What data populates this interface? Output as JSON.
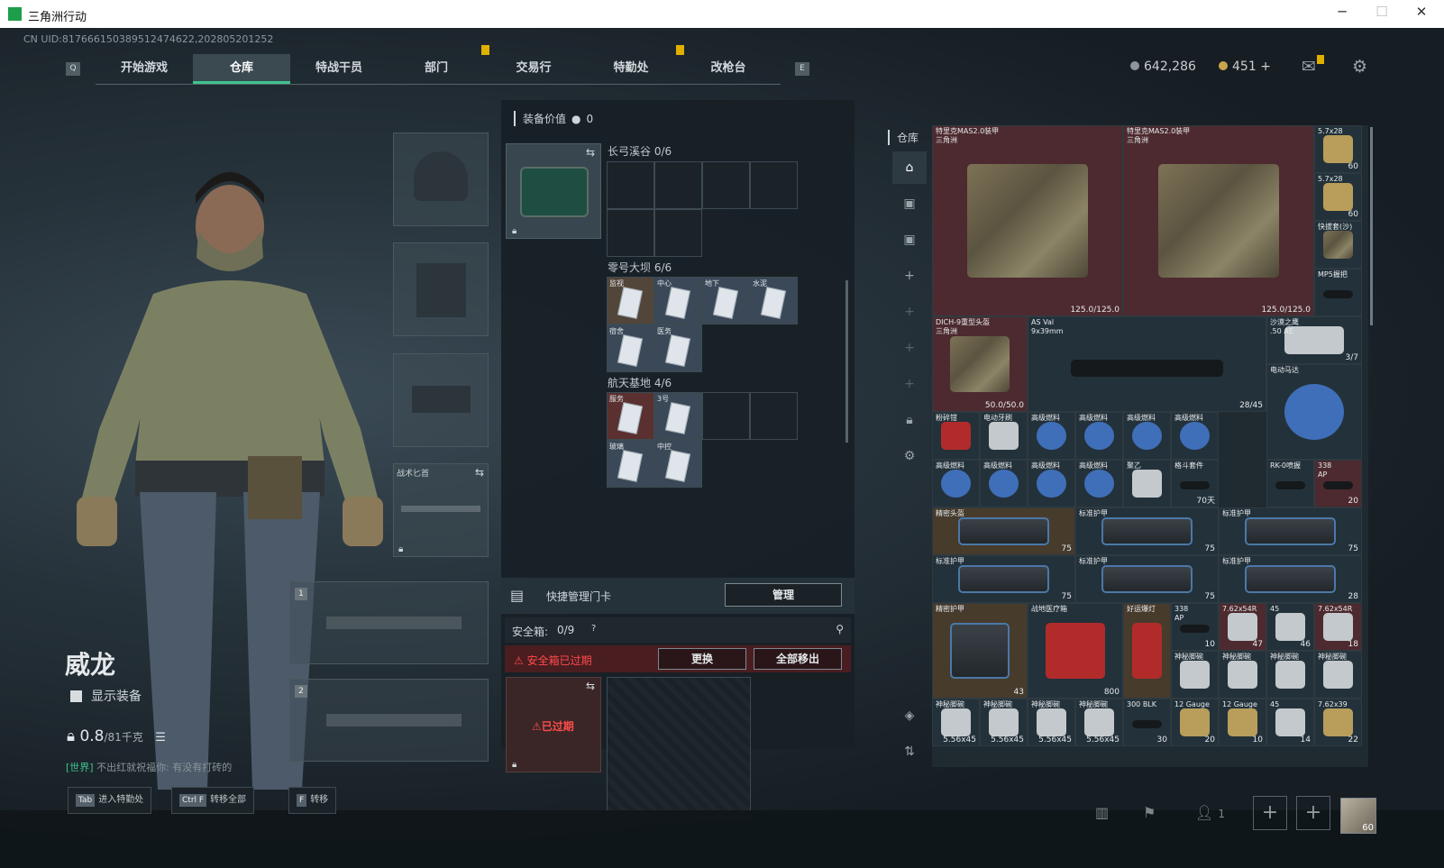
{
  "window": {
    "title": "三角洲行动"
  },
  "uid": "CN UID:817666150389512474622,202805201252",
  "nav": {
    "tabs": [
      {
        "label": "开始游戏"
      },
      {
        "label": "仓库",
        "active": true
      },
      {
        "label": "特战干员"
      },
      {
        "label": "部门"
      },
      {
        "label": "交易行"
      },
      {
        "label": "特勤处"
      },
      {
        "label": "改枪台"
      }
    ],
    "key_left": "Q",
    "key_right": "E"
  },
  "currency": {
    "silver": "642,286",
    "gold": "451",
    "gold_plus": "+"
  },
  "operator": {
    "name": "威龙",
    "show_equipment_label": "显示装备",
    "weight_value": "0.8",
    "weight_limit": "/81千克",
    "chat_channel": "[世界]",
    "chat_user": "不出红就祝福你",
    "chat_msg": "有没有打砖的"
  },
  "equipment": {
    "melee_label": "战术匕首",
    "primary_slot": "1",
    "secondary_slot": "2"
  },
  "loadout": {
    "title": "装备价值",
    "value": "0",
    "keycard_groups": [
      {
        "title": "长弓溪谷",
        "count": "0/6",
        "cards": []
      },
      {
        "title": "零号大坝",
        "count": "6/6",
        "cards": [
          "监视",
          "中心",
          "地下",
          "水泥",
          "宿舍",
          "医务"
        ]
      },
      {
        "title": "航天基地",
        "count": "4/6",
        "cards": [
          "服务",
          "3号",
          "玻璃",
          "中控"
        ]
      }
    ],
    "quick_manage_label": "快捷管理门卡",
    "manage_button": "管理",
    "safe_box_label": "安全箱:",
    "safe_box_count": "0/9",
    "safe_expired_msg": "安全箱已过期",
    "replace_button": "更换",
    "move_all_button": "全部移出",
    "case_expired_label": "已过期"
  },
  "stash": {
    "title": "仓库",
    "items": [
      {
        "name": "特里克MAS2.0装甲\n三角洲",
        "value": "125.0/125.0"
      },
      {
        "name": "特里克MAS2.0装甲\n三角洲",
        "value": "125.0/125.0"
      },
      {
        "name": "5.7x28",
        "value": "60"
      },
      {
        "name": "5.7x28",
        "value": "60"
      },
      {
        "name": "快拔套(沙)",
        "value": ""
      },
      {
        "name": "MP5握把",
        "value": ""
      },
      {
        "name": "DICH-9重型头盔\n三角洲",
        "value": "50.0/50.0"
      },
      {
        "name": "AS Val\n9x39mm",
        "value": "28/45"
      },
      {
        "name": "沙漠之鹰\n.50 AE",
        "value": "3/7"
      },
      {
        "name": "电动马达",
        "value": ""
      },
      {
        "name": "粉碎钳",
        "value": ""
      },
      {
        "name": "电动牙刷",
        "value": ""
      },
      {
        "name": "高级燃料",
        "value": ""
      },
      {
        "name": "高级燃料",
        "value": ""
      },
      {
        "name": "高级燃料",
        "value": ""
      },
      {
        "name": "高级燃料",
        "value": ""
      },
      {
        "name": "高级燃料",
        "value": ""
      },
      {
        "name": "高级燃料",
        "value": ""
      },
      {
        "name": "高级燃料",
        "value": ""
      },
      {
        "name": "高级燃料",
        "value": ""
      },
      {
        "name": "聚乙",
        "value": ""
      },
      {
        "name": "格斗套件",
        "value": "70天"
      },
      {
        "name": "RK-0喷握",
        "value": ""
      },
      {
        "name": "338\nAP",
        "value": "20"
      },
      {
        "name": "精密头盔",
        "value": "75"
      },
      {
        "name": "标准护甲",
        "value": "75"
      },
      {
        "name": "标准护甲",
        "value": "75"
      },
      {
        "name": "标准护甲",
        "value": "75"
      },
      {
        "name": "标准护甲",
        "value": "75"
      },
      {
        "name": "标准护甲",
        "value": "28"
      },
      {
        "name": "精密护甲",
        "value": "43"
      },
      {
        "name": "战地医疗箱",
        "value": "800"
      },
      {
        "name": "好运爆灯",
        "value": ""
      },
      {
        "name": "338\nAP",
        "value": "10"
      },
      {
        "name": "7.62x54R",
        "value": "47"
      },
      {
        "name": "45",
        "value": "46"
      },
      {
        "name": "7.62x54R",
        "value": "18"
      },
      {
        "name": "神秘脚碗",
        "value": ""
      },
      {
        "name": "神秘脚碗",
        "value": ""
      },
      {
        "name": "神秘脚碗",
        "value": ""
      },
      {
        "name": "神秘脚碗",
        "value": ""
      },
      {
        "name": "神秘脚碗",
        "value": "5.56x45"
      },
      {
        "name": "神秘脚碗",
        "value": "5.56x45"
      },
      {
        "name": "神秘脚碗",
        "value": "5.56x45"
      },
      {
        "name": "神秘脚碗",
        "value": "5.56x45"
      },
      {
        "name": "300 BLK",
        "value": "30"
      },
      {
        "name": "12 Gauge",
        "value": "20"
      },
      {
        "name": "12 Gauge",
        "value": "10"
      },
      {
        "name": "45",
        "value": "14"
      },
      {
        "name": "7.62x39",
        "value": "22"
      }
    ]
  },
  "bottom": {
    "hints": [
      {
        "key": "Tab",
        "label": "进入特勤处"
      },
      {
        "key": "Ctrl F",
        "label": "转移全部"
      },
      {
        "key": "F",
        "label": "转移"
      }
    ],
    "squad_count": "1",
    "avatar_level": "60"
  }
}
